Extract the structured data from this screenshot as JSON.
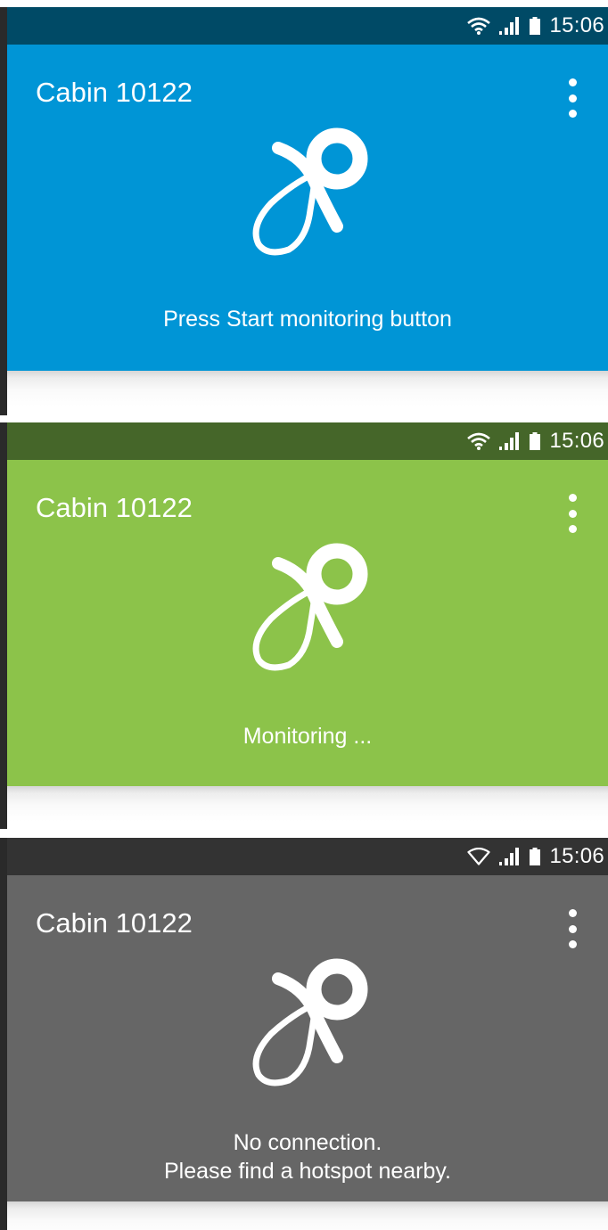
{
  "colors": {
    "blue": {
      "status_bar": "#004a66",
      "app_bar": "#0095d6"
    },
    "green": {
      "status_bar": "#456629",
      "app_bar": "#8cc34a"
    },
    "grey": {
      "status_bar": "#333333",
      "app_bar": "#666666"
    }
  },
  "icons": {
    "status_bar": [
      "wifi-icon",
      "signal-icon",
      "battery-icon"
    ],
    "status_bar_no_connection": [
      "wifi-empty-icon",
      "signal-icon",
      "battery-icon"
    ],
    "menu": "more-vert-icon",
    "main": "pacifier-icon"
  },
  "screens": [
    {
      "state": "idle",
      "status_bar": {
        "time": "15:06"
      },
      "title": "Cabin 10122",
      "message_lines": [
        "Press Start monitoring button"
      ]
    },
    {
      "state": "monitoring",
      "status_bar": {
        "time": "15:06"
      },
      "title": "Cabin 10122",
      "message_lines": [
        "Monitoring ..."
      ]
    },
    {
      "state": "no-connection",
      "status_bar": {
        "time": "15:06"
      },
      "title": "Cabin 10122",
      "message_lines": [
        "No connection.",
        "Please find a hotspot nearby."
      ]
    }
  ]
}
